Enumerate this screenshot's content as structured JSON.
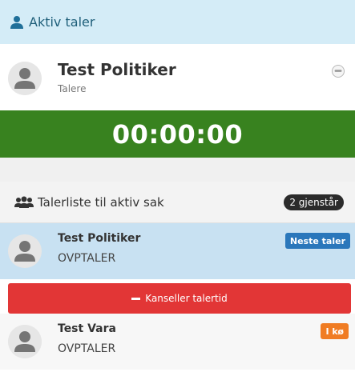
{
  "header": {
    "title": "Aktiv taler",
    "icon": "user-icon",
    "color": "#d4ecf7"
  },
  "active_speaker": {
    "name": "Test Politiker",
    "role": "Talere",
    "avatar_icon": "avatar-placeholder-icon",
    "pause_icon": "pause-icon"
  },
  "timer": {
    "value": "00:00:00",
    "color": "#38821f"
  },
  "speaker_list": {
    "title": "Talerliste til aktiv sak",
    "icon": "group-icon",
    "remaining": "2 gjenstår",
    "items": [
      {
        "name": "Test Politiker",
        "role": "OVPTALER",
        "badge": "Neste taler",
        "badge_color": "#2a77bb",
        "row_color": "#c8e1f2"
      },
      {
        "name": "Test Vara",
        "role": "OVPTALER",
        "badge": "I kø",
        "badge_color": "#f07c23",
        "row_color": "#f7f7f7"
      }
    ],
    "cancel_label": "Kanseller talertid",
    "cancel_color": "#e23636"
  }
}
